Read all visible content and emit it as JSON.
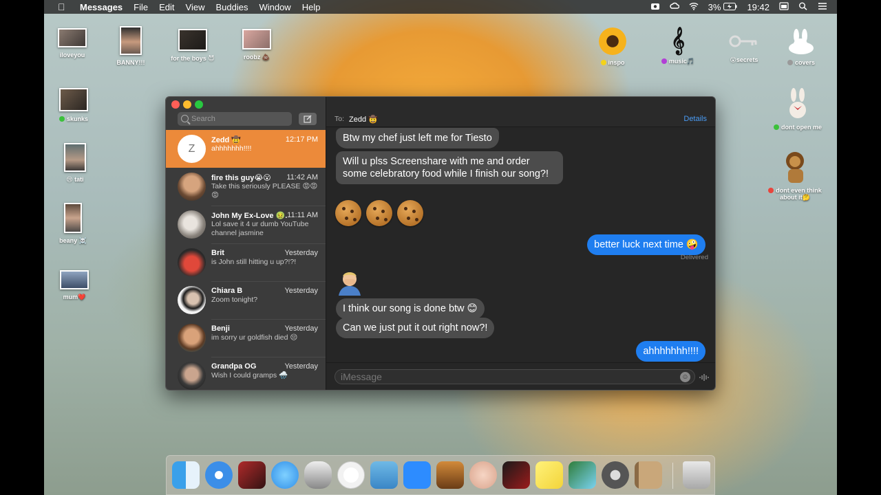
{
  "menubar": {
    "app_name": "Messages",
    "items": [
      "File",
      "Edit",
      "View",
      "Buddies",
      "Window",
      "Help"
    ],
    "battery": "3%",
    "time": "19:42"
  },
  "desktop": {
    "icons": [
      {
        "label": "iloveyou"
      },
      {
        "label": "BANNY!!!"
      },
      {
        "label": "for the boys 😈"
      },
      {
        "label": "roobz 💩"
      },
      {
        "label": "skunks",
        "tag_color": "#3cc13b"
      },
      {
        "label": "😢 tati"
      },
      {
        "label": "beany ☠️"
      },
      {
        "label": "mum❤️"
      },
      {
        "label": "inspo",
        "tag_color": "#f4d31a"
      },
      {
        "label": "music🎵",
        "tag_color": "#b23fd6"
      },
      {
        "label": "😮secrets"
      },
      {
        "label": "covers",
        "tag_color": "#9a9a9a"
      },
      {
        "label": "dont open me",
        "tag_color": "#3cc13b"
      },
      {
        "label": "dont even think about it🤔",
        "tag_color": "#e8453c"
      }
    ]
  },
  "sidebar": {
    "search_placeholder": "Search",
    "conversations": [
      {
        "name": "Zedd 🤠",
        "time": "12:17 PM",
        "preview": "ahhhhhhh!!!!",
        "avatar_letter": "Z",
        "active": true
      },
      {
        "name": "fire this guy😭😮",
        "time": "11:42 AM",
        "preview": "Take this seriously PLEASE 😡😡😡"
      },
      {
        "name": "John My Ex-Love 🤢...",
        "time": "11:11 AM",
        "preview": "Lol save it 4 ur dumb YouTube channel jasmine"
      },
      {
        "name": "Brit",
        "time": "Yesterday",
        "preview": "is John still hitting u up?!?!"
      },
      {
        "name": "Chiara B",
        "time": "Yesterday",
        "preview": "Zoom tonight?"
      },
      {
        "name": "Benji",
        "time": "Yesterday",
        "preview": "im sorry ur goldfish died 😔"
      },
      {
        "name": "Grandpa OG",
        "time": "Yesterday",
        "preview": "Wish I could gramps 🌧️"
      }
    ]
  },
  "chat": {
    "to_label": "To:",
    "recipient": "Zedd 🤠",
    "details": "Details",
    "messages": [
      {
        "dir": "in",
        "text": "Btw my chef just left me for Tiesto"
      },
      {
        "dir": "in",
        "text": "Will u plss Screenshare with me and order some celebratory food while I finish our song?!"
      },
      {
        "dir": "out",
        "text": "better luck next time 🤪"
      },
      {
        "dir": "in",
        "text": "I think our song is done btw 😊"
      },
      {
        "dir": "in",
        "text": "Can we just put it out right now?!"
      },
      {
        "dir": "out",
        "text": "ahhhhhhh!!!!"
      }
    ],
    "delivered": "Delivered",
    "input_placeholder": "iMessage"
  },
  "colors": {
    "accent_orange": "#ec8a3a",
    "bubble_blue": "#1f7ef0",
    "bubble_gray": "#4c4c4c",
    "link_blue": "#4a9cf5"
  }
}
